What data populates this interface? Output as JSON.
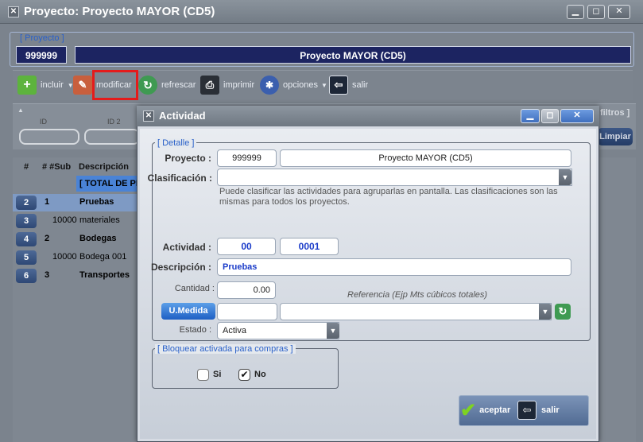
{
  "main": {
    "title": "Proyecto: Proyecto MAYOR (CD5)",
    "window_buttons": {
      "minimize": "▁",
      "maximize": "◻",
      "close": "✕"
    },
    "project_legend": "[ Proyecto ]",
    "project_code": "999999",
    "project_name": "Proyecto MAYOR (CD5)"
  },
  "toolbar": {
    "incluir": "incluir",
    "modificar": "modificar",
    "refrescar": "refrescar",
    "imprimir": "imprimir",
    "opciones": "opciones",
    "salir": "salir"
  },
  "filters": {
    "col1": "ID",
    "col2": "ID 2",
    "filtros": "filtros ]",
    "limpiar": "Limpiar"
  },
  "grid": {
    "headers": [
      "#",
      "# #Sub",
      "Descripción"
    ],
    "total_label": "[ TOTAL DE PR",
    "rows": [
      {
        "num": "2",
        "sub": "1",
        "desc": "Pruebas",
        "bold": true
      },
      {
        "num": "3",
        "sub": "10000",
        "desc": "materiales",
        "bold": false
      },
      {
        "num": "4",
        "sub": "2",
        "desc": "Bodegas",
        "bold": true
      },
      {
        "num": "5",
        "sub": "10000",
        "desc": "Bodega 001",
        "bold": false
      },
      {
        "num": "6",
        "sub": "3",
        "desc": "Transportes",
        "bold": true
      }
    ]
  },
  "dialog": {
    "title": "Actividad",
    "detalle_legend": "[ Detalle ]",
    "proyecto_label": "Proyecto :",
    "proyecto_code": "999999",
    "proyecto_name": "Proyecto MAYOR (CD5)",
    "clasificacion_label": "Clasificación :",
    "clasificacion_value": "",
    "clasificacion_hint": "Puede clasificar las actividades para agruparlas en pantalla. Las clasificaciones son las mismas para todos los proyectos.",
    "actividad_label": "Actividad :",
    "actividad_part1": "00",
    "actividad_part2": "0001",
    "descripcion_label": "Descripción :",
    "descripcion_value": "Pruebas",
    "cantidad_label": "Cantidad :",
    "cantidad_value": "0.00",
    "referencia_hint": "Referencia (Ejp Mts cúbicos totales)",
    "umedida_button": "U.Medida",
    "umedida_code": "",
    "umedida_desc": "",
    "estado_label": "Estado :",
    "estado_value": "Activa",
    "bloquear_legend": "[ Bloquear activada para compras ]",
    "si_label": "Si",
    "no_label": "No",
    "si_checked": false,
    "no_checked": true,
    "aceptar": "aceptar",
    "salir": "salir"
  },
  "colors": {
    "highlight": "#e51b1b",
    "project_bar": "#1c2461",
    "accent_blue": "#2a61c9",
    "row_badge": "#3a5686"
  }
}
